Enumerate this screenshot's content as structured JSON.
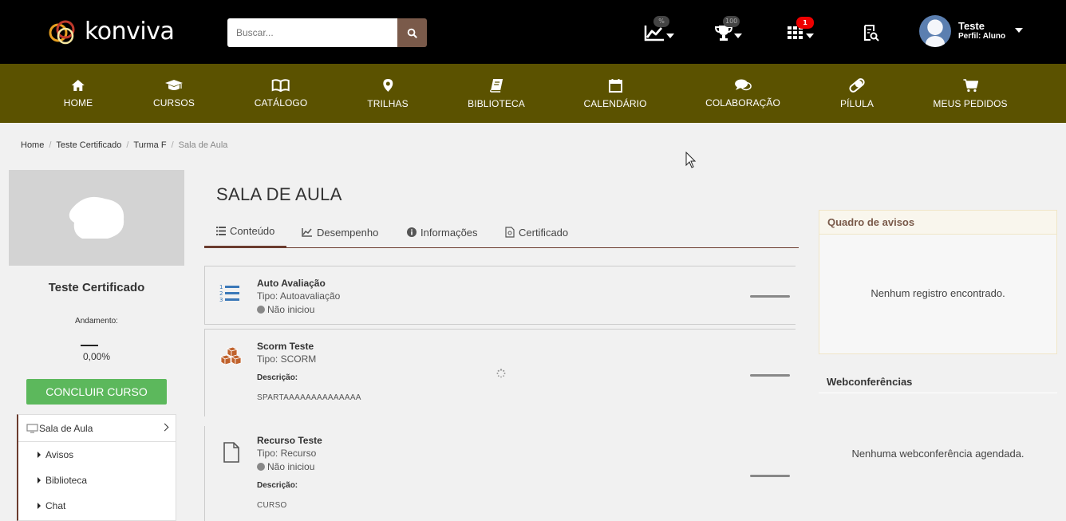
{
  "header": {
    "logo_text": "konviva",
    "search_placeholder": "Buscar...",
    "performance_badge": "%",
    "trophy_badge": "100",
    "apps_badge": "1",
    "user_name": "Teste",
    "user_role": "Perfil: Aluno"
  },
  "nav": {
    "items": [
      {
        "label": "HOME",
        "icon": "home-icon"
      },
      {
        "label": "CURSOS",
        "icon": "graduation-cap-icon"
      },
      {
        "label": "CATÁLOGO",
        "icon": "open-book-icon"
      },
      {
        "label": "TRILHAS",
        "icon": "map-pin-icon"
      },
      {
        "label": "BIBLIOTECA",
        "icon": "book-icon"
      },
      {
        "label": "CALENDÁRIO",
        "icon": "calendar-icon"
      },
      {
        "label": "COLABORAÇÃO",
        "icon": "comments-icon"
      },
      {
        "label": "PÍLULA",
        "icon": "pill-icon"
      },
      {
        "label": "MEUS PEDIDOS",
        "icon": "cart-icon"
      }
    ]
  },
  "breadcrumb": {
    "items": [
      "Home",
      "Teste Certificado",
      "Turma F"
    ],
    "current": "Sala de Aula"
  },
  "course": {
    "title": "Teste Certificado",
    "progress_label": "Andamento:",
    "progress_value": "0,00%",
    "conclude_label": "CONCLUIR CURSO"
  },
  "side_menu": {
    "main": "Sala de Aula",
    "items": [
      "Avisos",
      "Biblioteca",
      "Chat"
    ]
  },
  "main": {
    "title": "SALA DE AULA",
    "tabs": [
      {
        "label": "Conteúdo",
        "icon": "list-icon"
      },
      {
        "label": "Desempenho",
        "icon": "line-chart-icon"
      },
      {
        "label": "Informações",
        "icon": "info-circle-icon"
      },
      {
        "label": "Certificado",
        "icon": "certificate-icon"
      }
    ],
    "items": [
      {
        "title": "Auto Avaliação",
        "type": "Tipo: Autoavaliação",
        "status": "Não iniciou",
        "icon": "numbered-list-icon"
      },
      {
        "title": "Scorm Teste",
        "type": "Tipo: SCORM",
        "desc_label": "Descrição:",
        "desc": "SPARTAAAAAAAAAAAAAA",
        "icon": "cubes-icon"
      },
      {
        "title": "Recurso Teste",
        "type": "Tipo: Recurso",
        "status": "Não iniciou",
        "desc_label": "Descrição:",
        "desc": "CURSO",
        "icon": "file-icon"
      }
    ]
  },
  "right": {
    "notice_title": "Quadro de avisos",
    "notice_empty": "Nenhum registro encontrado.",
    "webconf_title": "Webconferências",
    "webconf_empty": "Nenhuma webconferência agendada."
  },
  "colors": {
    "topbar": "#000000",
    "nav": "#5b5200",
    "accent": "#6b3c2f",
    "button_green": "#5cb85c",
    "background": "#f1f1f1"
  }
}
